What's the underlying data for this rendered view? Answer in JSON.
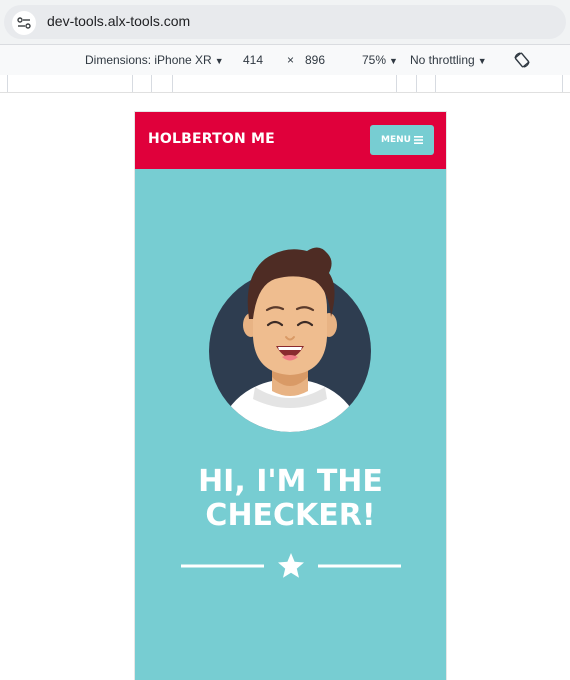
{
  "browser": {
    "url": "dev-tools.alx-tools.com"
  },
  "devtools": {
    "dimensions_label": "Dimensions: iPhone XR",
    "width": "414",
    "times": "×",
    "height": "896",
    "zoom": "75%",
    "throttling": "No throttling"
  },
  "page": {
    "brand": "HOLBERTON ME",
    "menu_label": "MENU",
    "headline_line1": "HI, I'M THE",
    "headline_line2": "CHECKER!"
  },
  "colors": {
    "header": "#e0003b",
    "background": "#77cdd2",
    "avatar_circle": "#2e3d50",
    "text": "#ffffff"
  },
  "icons": [
    "site-settings-icon",
    "hamburger-icon",
    "rotate-icon",
    "star-icon"
  ]
}
